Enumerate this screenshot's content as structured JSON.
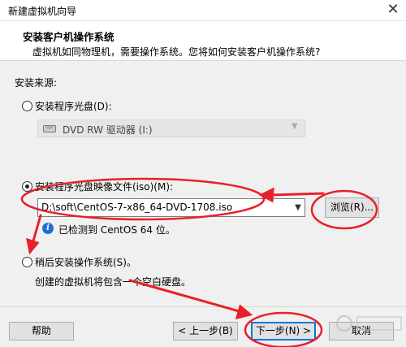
{
  "window": {
    "title": "新建虚拟机向导",
    "close_glyph": "✕"
  },
  "header": {
    "title": "安装客户机操作系统",
    "subtitle": "虚拟机如同物理机，需要操作系统。您将如何安装客户机操作系统?"
  },
  "source": {
    "label": "安装来源:",
    "disc_option": {
      "label": "安装程序光盘(D):",
      "selected": false
    },
    "drive_select": {
      "value": "DVD RW 驱动器 (I:)",
      "icon": "dvd-drive-icon",
      "enabled": false
    },
    "iso_option": {
      "label": "安装程序光盘映像文件(iso)(M):",
      "selected": true
    },
    "iso_path": {
      "value": "D:\\soft\\CentOS-7-x86_64-DVD-1708.iso"
    },
    "browse_label": "浏览(R)...",
    "detected_text": "已检测到 CentOS 64 位。",
    "later_option": {
      "label": "稍后安装操作系统(S)。",
      "selected": false
    },
    "later_desc": "创建的虚拟机将包含一个空白硬盘。"
  },
  "footer": {
    "help_label": "帮助",
    "back_label": "< 上一步(B)",
    "next_label": "下一步(N) >",
    "cancel_label": "取消"
  },
  "annotation_color": "#e8202a"
}
